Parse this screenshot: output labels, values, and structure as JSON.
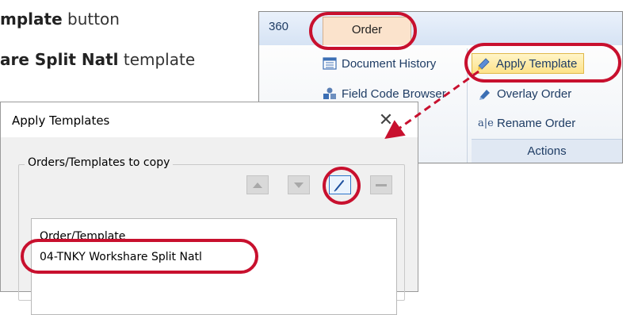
{
  "instructions": {
    "line1_bold": "mplate",
    "line1_rest": " button",
    "line2_bold": "are Split Natl",
    "line2_rest": " template"
  },
  "ribbon": {
    "tabs": [
      {
        "label": "360"
      },
      {
        "label": "Order"
      }
    ],
    "items": {
      "document_history": "Document History",
      "field_code_browser": "Field Code Browser",
      "apply_template": "Apply Template",
      "overlay_order": "Overlay Order",
      "rename_order": "Rename Order"
    },
    "rename_icon_text": "a|e",
    "group_label": "Actions"
  },
  "dialog": {
    "title": "Apply Templates",
    "close_glyph": "✕",
    "group_label": "Orders/Templates to copy",
    "list": {
      "header": "Order/Template",
      "items": [
        "04-TNKY Workshare Split Natl"
      ]
    }
  },
  "colors": {
    "highlight_red": "#c8102e",
    "ribbon_tab_active": "#fbe3cc",
    "ribbon_text": "#1e3c64",
    "apply_template_highlight": "#fde28a"
  }
}
